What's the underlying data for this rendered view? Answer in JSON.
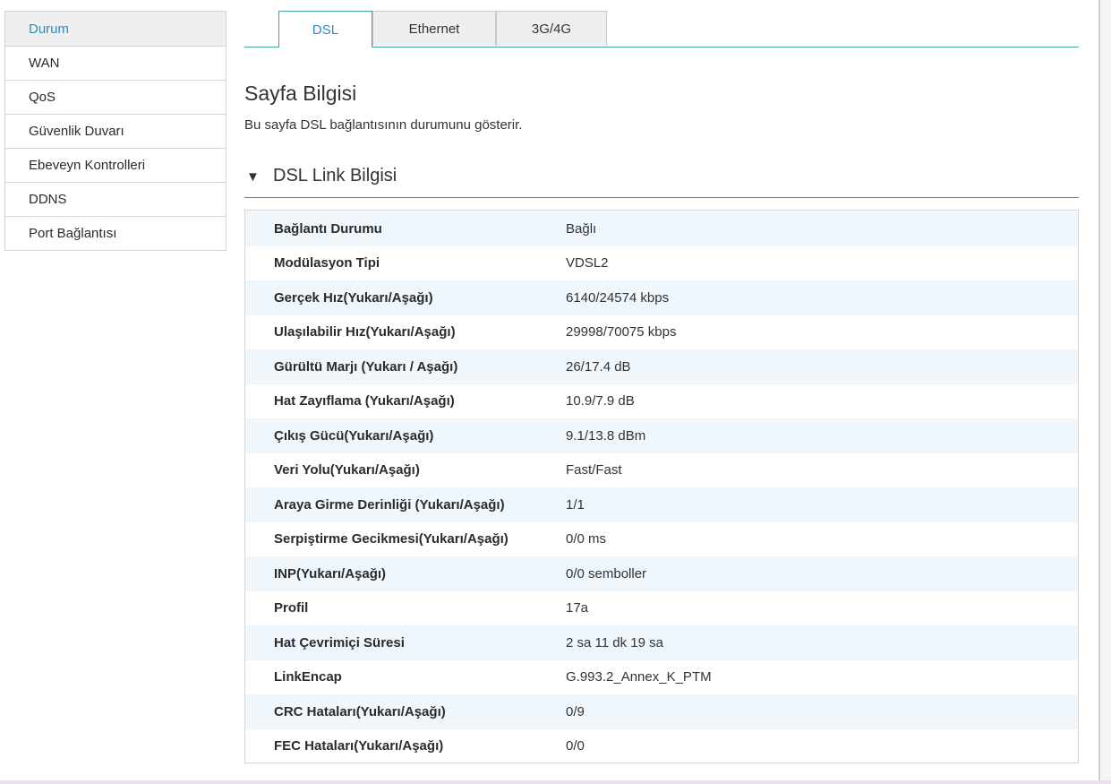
{
  "sidebar": {
    "items": [
      {
        "label": "Durum"
      },
      {
        "label": "WAN"
      },
      {
        "label": "QoS"
      },
      {
        "label": "Güvenlik Duvarı"
      },
      {
        "label": "Ebeveyn Kontrolleri"
      },
      {
        "label": "DDNS"
      },
      {
        "label": "Port Bağlantısı"
      }
    ],
    "active_index": 0
  },
  "tabs": [
    {
      "label": "DSL"
    },
    {
      "label": "Ethernet"
    },
    {
      "label": "3G/4G"
    }
  ],
  "page": {
    "title": "Sayfa Bilgisi",
    "description": "Bu sayfa DSL bağlantısının durumunu gösterir."
  },
  "section": {
    "toggle_icon": "▼",
    "title": "DSL Link Bilgisi"
  },
  "rows": [
    {
      "label": "Bağlantı Durumu",
      "value": "Bağlı"
    },
    {
      "label": "Modülasyon Tipi",
      "value": "VDSL2"
    },
    {
      "label": "Gerçek Hız(Yukarı/Aşağı)",
      "value": "6140/24574 kbps"
    },
    {
      "label": "Ulaşılabilir Hız(Yukarı/Aşağı)",
      "value": "29998/70075 kbps"
    },
    {
      "label": "Gürültü Marjı (Yukarı / Aşağı)",
      "value": "26/17.4 dB"
    },
    {
      "label": "Hat Zayıflama (Yukarı/Aşağı)",
      "value": "10.9/7.9 dB"
    },
    {
      "label": "Çıkış Gücü(Yukarı/Aşağı)",
      "value": "9.1/13.8 dBm"
    },
    {
      "label": "Veri Yolu(Yukarı/Aşağı)",
      "value": "Fast/Fast"
    },
    {
      "label": "Araya Girme Derinliği (Yukarı/Aşağı)",
      "value": "1/1"
    },
    {
      "label": "Serpiştirme Gecikmesi(Yukarı/Aşağı)",
      "value": "0/0 ms"
    },
    {
      "label": "INP(Yukarı/Aşağı)",
      "value": "0/0 semboller"
    },
    {
      "label": "Profil",
      "value": "17a"
    },
    {
      "label": "Hat Çevrimiçi Süresi",
      "value": "2 sa 11 dk 19 sa"
    },
    {
      "label": "LinkEncap",
      "value": "G.993.2_Annex_K_PTM"
    },
    {
      "label": "CRC Hataları(Yukarı/Aşağı)",
      "value": "0/9"
    },
    {
      "label": "FEC Hataları(Yukarı/Aşağı)",
      "value": "0/0"
    }
  ],
  "colors": {
    "accent": "#2a8fbd",
    "tab_border": "#3aa0a0",
    "row_stripe": "#eff7fd"
  }
}
